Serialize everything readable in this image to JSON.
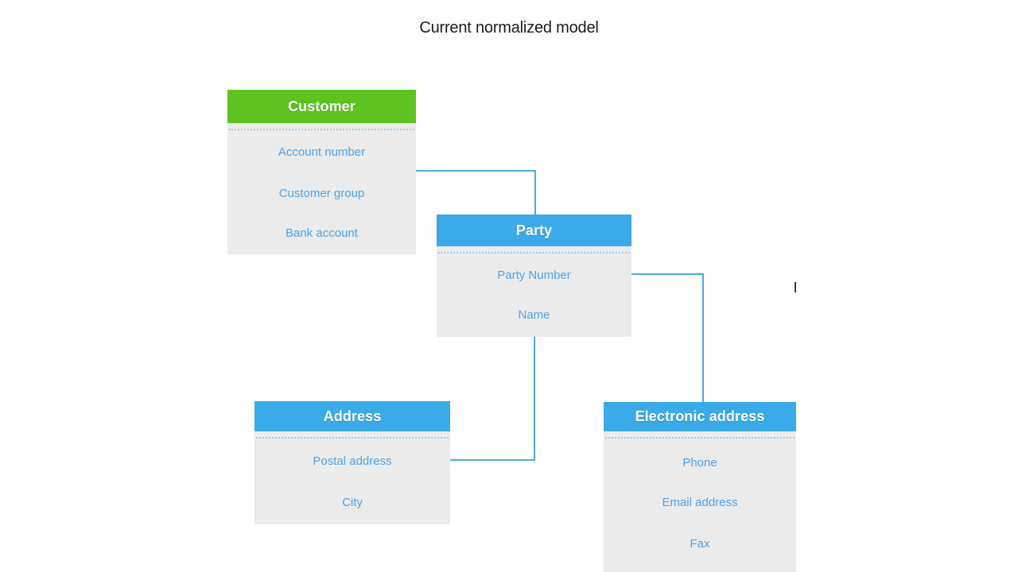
{
  "title": "Current normalized model",
  "colors": {
    "green_header": "#5cc320",
    "blue_header": "#3aaae8",
    "body_gray": "#ebebeb",
    "field_text": "#4da3e8",
    "connector": "#4fa9e0",
    "title_text": "#1a1a1a"
  },
  "entities": [
    {
      "id": "customer",
      "name": "Customer",
      "header_color": "green",
      "fields": [
        "Account number",
        "Customer group",
        "Bank account"
      ]
    },
    {
      "id": "party",
      "name": "Party",
      "header_color": "blue",
      "fields": [
        "Party Number",
        "Name"
      ]
    },
    {
      "id": "address",
      "name": "Address",
      "header_color": "blue",
      "fields": [
        "Postal address",
        "City"
      ]
    },
    {
      "id": "electronic-address",
      "name": "Electronic address",
      "header_color": "blue",
      "fields": [
        "Phone",
        "Email address",
        "Fax"
      ]
    }
  ],
  "connections": [
    {
      "from": "customer",
      "to": "party"
    },
    {
      "from": "party",
      "to": "electronic-address"
    },
    {
      "from": "party",
      "to": "address"
    }
  ]
}
